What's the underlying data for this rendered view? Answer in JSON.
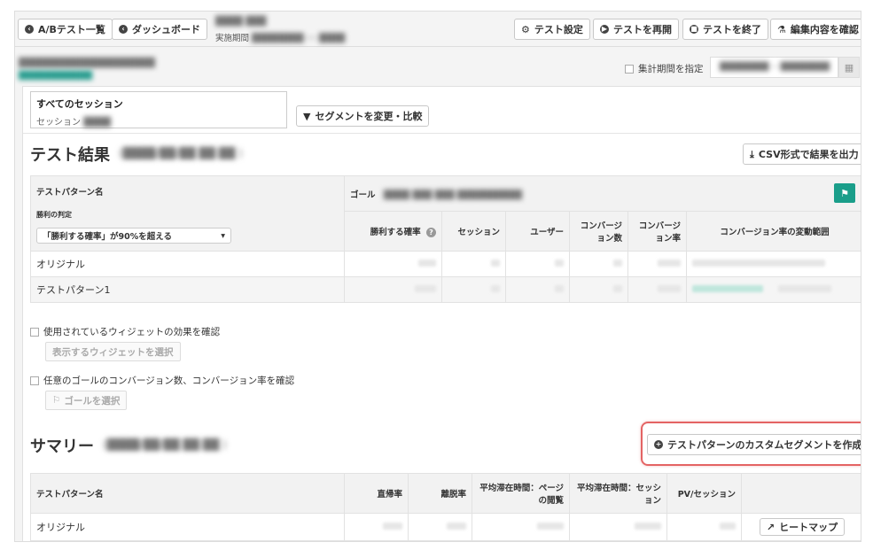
{
  "toolbar": {
    "ab_list": "A/Bテスト一覧",
    "dashboard": "ダッシュボード",
    "test_name": "████ ███",
    "period_label": "実施期間",
    "period_value": "████████ ── ████",
    "settings": "テスト設定",
    "resume": "テストを再開",
    "end": "テストを終了",
    "confirm_edit": "編集内容を確認"
  },
  "subbar": {
    "page_name": "████████████████████",
    "page_url": "████████████",
    "aggregate_period_label": "集計期間を指定",
    "date_range": "████████ ~ ████████"
  },
  "segment": {
    "title": "すべてのセッション",
    "subtitle_label": "セッション",
    "subtitle_value": "████",
    "change_button": "セグメントを変更・比較"
  },
  "results": {
    "title": "テスト結果",
    "timestamp": "(████/██/██ ██:██ )",
    "csv_button": "CSV形式で結果を出力",
    "pattern_col": "テストパターン名",
    "judge_label": "勝利の判定",
    "judge_select": "「勝利する確率」が90%を超える",
    "goal_label": "ゴール",
    "goal_value": "████ ███ ███ ██████████",
    "columns": [
      "勝利する確率",
      "セッション",
      "ユーザー",
      "コンバージョン数",
      "コンバージョン率",
      "コンバージョン率の変動範囲"
    ],
    "rows": [
      {
        "name": "オリジナル"
      },
      {
        "name": "テストパターン1"
      }
    ]
  },
  "options": {
    "widget_check": "使用されているウィジェットの効果を確認",
    "widget_button": "表示するウィジェットを選択",
    "goal_check": "任意のゴールのコンバージョン数、コンバージョン率を確認",
    "goal_button": "ゴールを選択"
  },
  "summary": {
    "title": "サマリー",
    "timestamp": "(████/██/██ ██:██ )",
    "custom_segment_button": "テストパターンのカスタムセグメントを作成",
    "pattern_col": "テストパターン名",
    "columns": [
      "直帰率",
      "離脱率",
      "平均滞在時間：ページの閲覧",
      "平均滞在時間：セッション",
      "PV/セッション"
    ],
    "rows": [
      {
        "name": "オリジナル",
        "heatmap": "ヒートマップ"
      }
    ]
  },
  "colors": {
    "accent_teal": "#1a9e8a",
    "highlight_red": "#e46464"
  }
}
